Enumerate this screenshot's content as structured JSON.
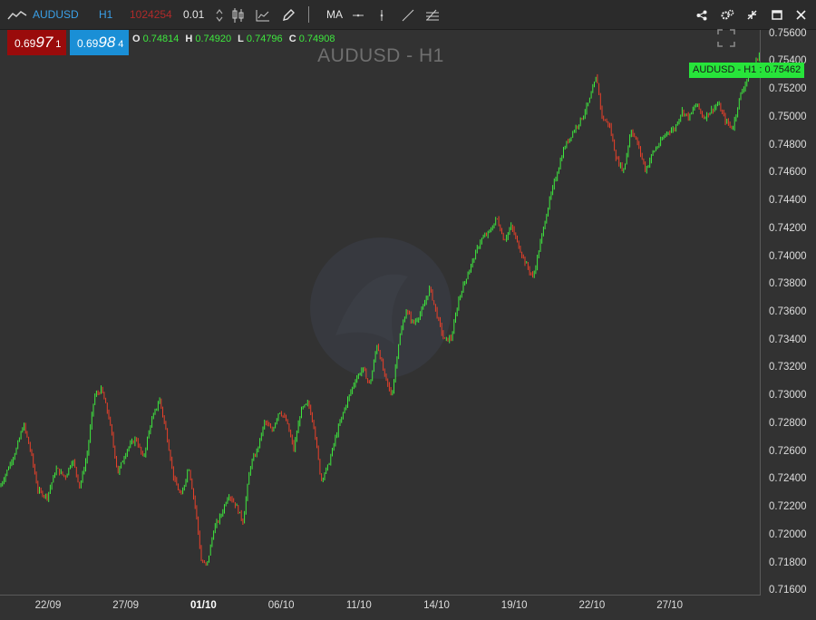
{
  "toolbar": {
    "symbol": "AUDUSD",
    "timeframe": "H1",
    "account_value": "1024254",
    "lot_size": "0.01",
    "ma_label": "MA"
  },
  "sell_box": {
    "prefix": "0.69",
    "big": "97",
    "small": "1",
    "color": "#9a0b0b"
  },
  "buy_box": {
    "prefix": "0.69",
    "big": "98",
    "small": "4",
    "color": "#1a8fd6"
  },
  "ohlc": {
    "o_label": "O",
    "o": "0.74814",
    "h_label": "H",
    "h": "0.74920",
    "l_label": "L",
    "l": "0.74796",
    "c_label": "C",
    "c": "0.74908"
  },
  "chart_title": "AUDUSD - H1",
  "current_price_tag": "AUDUSD - H1 : 0.75462",
  "icons": [
    "line-chart-icon",
    "stepper-icon",
    "candlestick-icon",
    "area-chart-icon",
    "pencil-icon",
    "horizontal-line-icon",
    "vertical-line-icon",
    "trend-line-icon",
    "fibonacci-icon",
    "share-icon",
    "settings-icon",
    "collapse-icon",
    "maximize-icon",
    "close-icon",
    "fullscreen-icon"
  ],
  "colors": {
    "bull": "#3ee83e",
    "bear": "#e8402a",
    "accent": "#1a8fd6",
    "tag": "#27e43a"
  },
  "chart_data": {
    "type": "candlestick",
    "title": "AUDUSD - H1",
    "y_ticks": [
      "0.75600",
      "0.75400",
      "0.75200",
      "0.75000",
      "0.74800",
      "0.74600",
      "0.74400",
      "0.74200",
      "0.74000",
      "0.73800",
      "0.73600",
      "0.73400",
      "0.73200",
      "0.73000",
      "0.72800",
      "0.72600",
      "0.72400",
      "0.72200",
      "0.72000",
      "0.71800",
      "0.71600"
    ],
    "ylim": [
      0.7157,
      0.7563
    ],
    "x_ticks": [
      "22/09",
      "27/09",
      "01/10",
      "06/10",
      "11/10",
      "14/10",
      "19/10",
      "22/10",
      "27/10"
    ],
    "x_bold": "01/10",
    "anchors": [
      [
        0,
        0.7235
      ],
      [
        10,
        0.725
      ],
      [
        18,
        0.7262
      ],
      [
        26,
        0.728
      ],
      [
        34,
        0.726
      ],
      [
        42,
        0.7232
      ],
      [
        52,
        0.7228
      ],
      [
        62,
        0.7248
      ],
      [
        72,
        0.7242
      ],
      [
        80,
        0.7255
      ],
      [
        88,
        0.7235
      ],
      [
        96,
        0.7258
      ],
      [
        104,
        0.73
      ],
      [
        112,
        0.7305
      ],
      [
        120,
        0.7285
      ],
      [
        130,
        0.7245
      ],
      [
        140,
        0.7262
      ],
      [
        150,
        0.727
      ],
      [
        158,
        0.7255
      ],
      [
        166,
        0.728
      ],
      [
        176,
        0.7298
      ],
      [
        184,
        0.7272
      ],
      [
        192,
        0.724
      ],
      [
        200,
        0.7228
      ],
      [
        208,
        0.725
      ],
      [
        216,
        0.7218
      ],
      [
        222,
        0.7182
      ],
      [
        228,
        0.7178
      ],
      [
        236,
        0.7205
      ],
      [
        244,
        0.7215
      ],
      [
        252,
        0.723
      ],
      [
        260,
        0.7222
      ],
      [
        268,
        0.721
      ],
      [
        276,
        0.725
      ],
      [
        284,
        0.7262
      ],
      [
        292,
        0.7282
      ],
      [
        300,
        0.7275
      ],
      [
        308,
        0.729
      ],
      [
        316,
        0.7282
      ],
      [
        324,
        0.7262
      ],
      [
        332,
        0.729
      ],
      [
        340,
        0.7295
      ],
      [
        346,
        0.728
      ],
      [
        354,
        0.724
      ],
      [
        362,
        0.725
      ],
      [
        372,
        0.7275
      ],
      [
        382,
        0.7295
      ],
      [
        392,
        0.7312
      ],
      [
        400,
        0.732
      ],
      [
        408,
        0.7308
      ],
      [
        416,
        0.7338
      ],
      [
        424,
        0.7315
      ],
      [
        432,
        0.73
      ],
      [
        440,
        0.734
      ],
      [
        448,
        0.7362
      ],
      [
        456,
        0.7352
      ],
      [
        466,
        0.7362
      ],
      [
        474,
        0.7378
      ],
      [
        482,
        0.7358
      ],
      [
        490,
        0.734
      ],
      [
        498,
        0.7342
      ],
      [
        506,
        0.737
      ],
      [
        514,
        0.7385
      ],
      [
        522,
        0.7398
      ],
      [
        530,
        0.7412
      ],
      [
        540,
        0.7418
      ],
      [
        548,
        0.7428
      ],
      [
        556,
        0.7412
      ],
      [
        564,
        0.7422
      ],
      [
        572,
        0.7408
      ],
      [
        580,
        0.7395
      ],
      [
        588,
        0.7385
      ],
      [
        596,
        0.741
      ],
      [
        604,
        0.7435
      ],
      [
        612,
        0.7455
      ],
      [
        622,
        0.7478
      ],
      [
        632,
        0.749
      ],
      [
        642,
        0.75
      ],
      [
        650,
        0.7512
      ],
      [
        658,
        0.753
      ],
      [
        664,
        0.75
      ],
      [
        672,
        0.7495
      ],
      [
        680,
        0.747
      ],
      [
        688,
        0.7462
      ],
      [
        696,
        0.7492
      ],
      [
        704,
        0.748
      ],
      [
        712,
        0.7462
      ],
      [
        720,
        0.7475
      ],
      [
        728,
        0.7482
      ],
      [
        736,
        0.749
      ],
      [
        744,
        0.7492
      ],
      [
        752,
        0.7505
      ],
      [
        760,
        0.75
      ],
      [
        768,
        0.751
      ],
      [
        776,
        0.75
      ],
      [
        784,
        0.7505
      ],
      [
        792,
        0.751
      ],
      [
        800,
        0.7498
      ],
      [
        808,
        0.7492
      ],
      [
        816,
        0.7515
      ],
      [
        824,
        0.7528
      ],
      [
        832,
        0.7538
      ],
      [
        838,
        0.7546
      ]
    ]
  }
}
